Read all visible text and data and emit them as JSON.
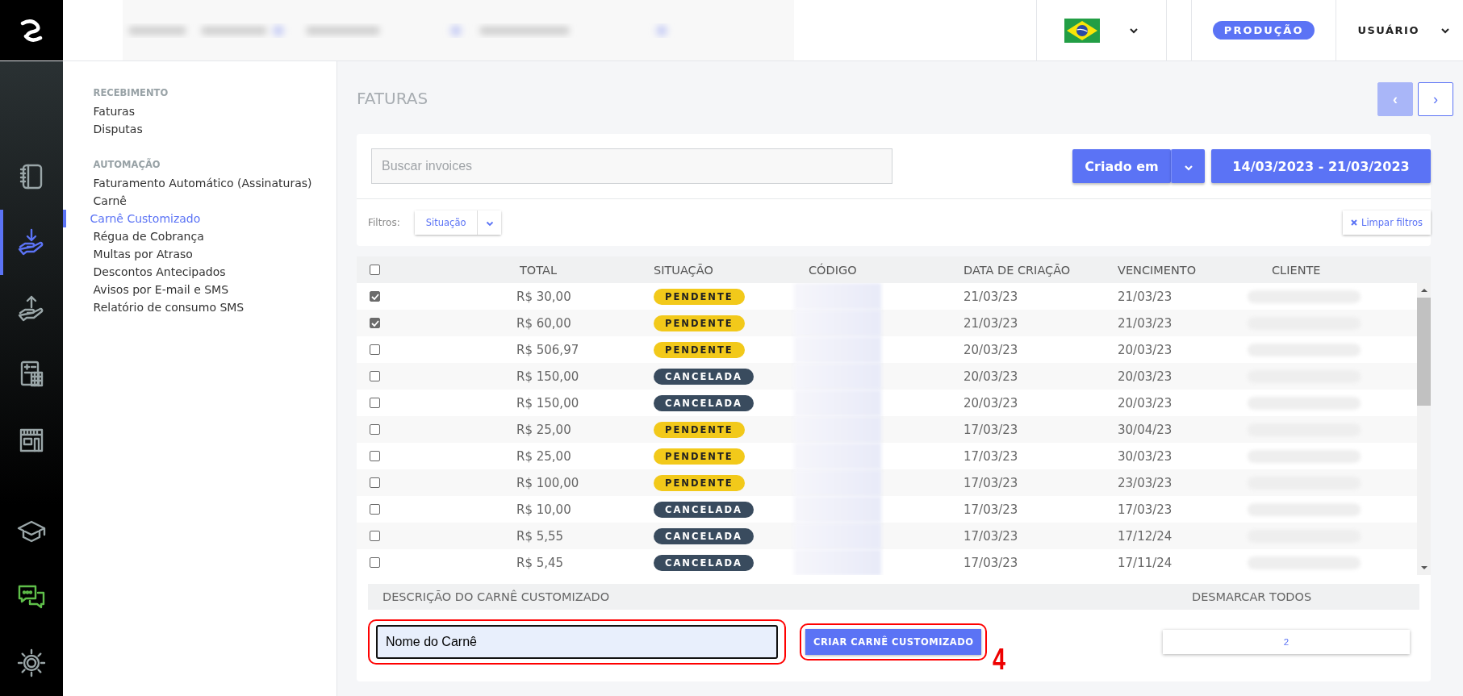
{
  "header": {
    "environment_badge": "PRODUÇÃO",
    "user_menu": "USUÁRIO"
  },
  "rail": [
    {
      "selected": false
    },
    {
      "selected": true
    },
    {
      "selected": false
    },
    {
      "selected": false
    },
    {
      "selected": false
    },
    {
      "selected": false
    },
    {
      "selected": false
    },
    {
      "selected": false
    }
  ],
  "submenu": [
    {
      "title": "RECEBIMENTO",
      "items": [
        {
          "label": "Faturas",
          "selected": false
        },
        {
          "label": "Disputas",
          "selected": false
        }
      ]
    },
    {
      "title": "AUTOMAÇÃO",
      "items": [
        {
          "label": "Faturamento Automático (Assinaturas)",
          "selected": false
        },
        {
          "label": "Carnê",
          "selected": false
        },
        {
          "label": "Carnê Customizado",
          "selected": true
        },
        {
          "label": "Régua de Cobrança",
          "selected": false
        },
        {
          "label": "Multas por Atraso",
          "selected": false
        },
        {
          "label": "Descontos Antecipados",
          "selected": false
        },
        {
          "label": "Avisos por E-mail e SMS",
          "selected": false
        },
        {
          "label": "Relatório de consumo SMS",
          "selected": false
        }
      ]
    }
  ],
  "page_title": "FATURAS",
  "pagination": {
    "prev": "‹",
    "next": "›",
    "prev_disabled": true
  },
  "search": {
    "placeholder": "Buscar invoices"
  },
  "sort_button": "Criado em",
  "date_range": "14/03/2023 - 21/03/2023",
  "filters": {
    "label": "Filtros:",
    "status_filter": "Situação",
    "clear": "Limpar filtros"
  },
  "table": {
    "all_checked": false,
    "columns": [
      "TOTAL",
      "SITUAÇÃO",
      "CÓDIGO",
      "DATA DE CRIAÇÃO",
      "VENCIMENTO",
      "CLIENTE"
    ],
    "rows": [
      {
        "checked": true,
        "total": "R$ 30,00",
        "status": "PENDENTE",
        "kind": "pending",
        "created": "21/03/23",
        "due": "21/03/23"
      },
      {
        "checked": true,
        "total": "R$ 60,00",
        "status": "PENDENTE",
        "kind": "pending",
        "created": "21/03/23",
        "due": "21/03/23"
      },
      {
        "checked": false,
        "total": "R$ 506,97",
        "status": "PENDENTE",
        "kind": "pending",
        "created": "20/03/23",
        "due": "20/03/23"
      },
      {
        "checked": false,
        "total": "R$ 150,00",
        "status": "CANCELADA",
        "kind": "cancelled",
        "created": "20/03/23",
        "due": "20/03/23"
      },
      {
        "checked": false,
        "total": "R$ 150,00",
        "status": "CANCELADA",
        "kind": "cancelled",
        "created": "20/03/23",
        "due": "20/03/23"
      },
      {
        "checked": false,
        "total": "R$ 25,00",
        "status": "PENDENTE",
        "kind": "pending",
        "created": "17/03/23",
        "due": "30/04/23"
      },
      {
        "checked": false,
        "total": "R$ 25,00",
        "status": "PENDENTE",
        "kind": "pending",
        "created": "17/03/23",
        "due": "30/03/23"
      },
      {
        "checked": false,
        "total": "R$ 100,00",
        "status": "PENDENTE",
        "kind": "pending",
        "created": "17/03/23",
        "due": "23/03/23"
      },
      {
        "checked": false,
        "total": "R$ 10,00",
        "status": "CANCELADA",
        "kind": "cancelled",
        "created": "17/03/23",
        "due": "17/03/23"
      },
      {
        "checked": false,
        "total": "R$ 5,55",
        "status": "CANCELADA",
        "kind": "cancelled",
        "created": "17/03/23",
        "due": "17/12/24"
      },
      {
        "checked": false,
        "total": "R$ 5,45",
        "status": "CANCELADA",
        "kind": "cancelled",
        "created": "17/03/23",
        "due": "17/11/24"
      }
    ]
  },
  "carne": {
    "description_header": "DESCRIÇÃO DO CARNÊ CUSTOMIZADO",
    "name_value": "Nome do Carnê",
    "create_button": "CRIAR CARNÊ CUSTOMIZADO",
    "deselect_header": "DESMARCAR TODOS",
    "deselect_button": "2"
  },
  "annotation": "4"
}
